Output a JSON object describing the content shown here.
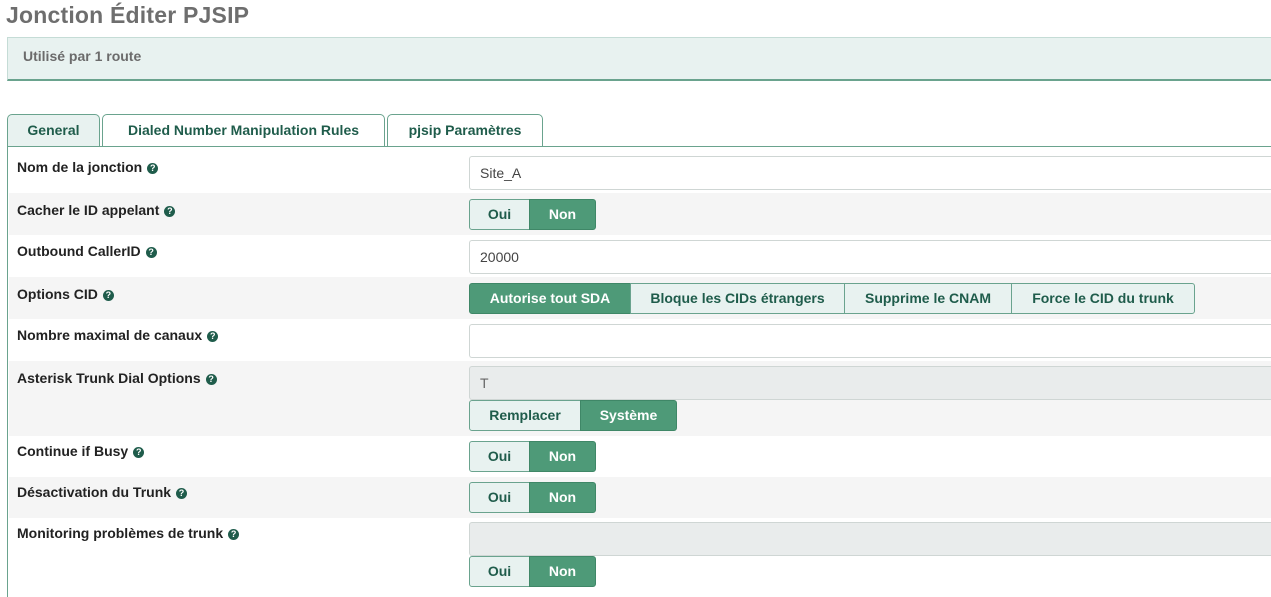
{
  "page": {
    "title": "Jonction Éditer PJSIP",
    "usage_note": "Utilisé par 1 route"
  },
  "tabs": [
    {
      "label": "General",
      "active": true
    },
    {
      "label": "Dialed Number Manipulation Rules",
      "active": false
    },
    {
      "label": "pjsip Paramètres",
      "active": false
    }
  ],
  "fields": {
    "trunk_name": {
      "label": "Nom de la jonction",
      "value": "Site_A"
    },
    "hide_callerid": {
      "label": "Cacher le ID appelant",
      "options": [
        "Oui",
        "Non"
      ],
      "selected": "Non"
    },
    "outbound_callerid": {
      "label": "Outbound CallerID",
      "value": "20000"
    },
    "cid_options": {
      "label": "Options CID",
      "options": [
        "Autorise tout SDA",
        "Bloque les CIDs étrangers",
        "Supprime le CNAM",
        "Force le CID du trunk"
      ],
      "selected": "Autorise tout SDA"
    },
    "max_channels": {
      "label": "Nombre maximal de canaux",
      "value": ""
    },
    "dial_options": {
      "label": "Asterisk Trunk Dial Options",
      "value": "T",
      "options": [
        "Remplacer",
        "Système"
      ],
      "selected": "Système"
    },
    "continue_if_busy": {
      "label": "Continue if Busy",
      "options": [
        "Oui",
        "Non"
      ],
      "selected": "Non"
    },
    "disable_trunk": {
      "label": "Désactivation du Trunk",
      "options": [
        "Oui",
        "Non"
      ],
      "selected": "Non"
    },
    "monitor_trunk": {
      "label": "Monitoring problèmes de trunk",
      "value": "",
      "options": [
        "Oui",
        "Non"
      ],
      "selected": "Non"
    }
  },
  "help_glyph": "?",
  "icons": {
    "help": "question-circle-icon"
  },
  "colors": {
    "accent": "#4e9a78",
    "accent_dark": "#1f5c4b",
    "light": "#e8f2f0"
  }
}
